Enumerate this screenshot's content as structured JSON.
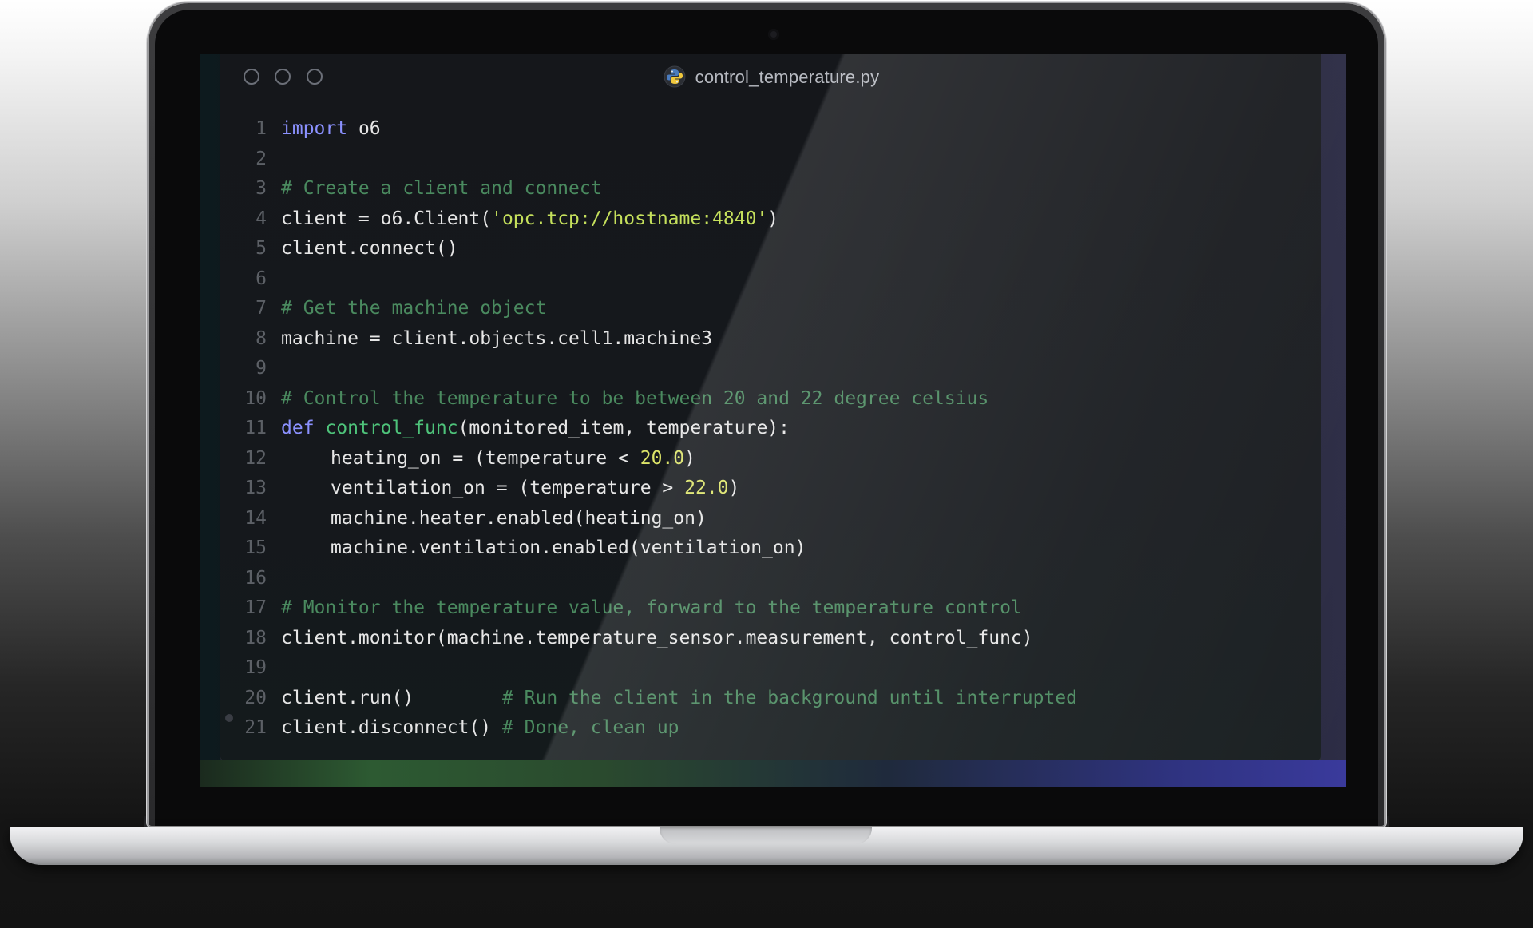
{
  "window": {
    "file_name": "control_temperature.py",
    "file_icon": "python-icon"
  },
  "code_lines": [
    {
      "n": "1",
      "tokens": [
        {
          "t": "import",
          "c": "kw"
        },
        {
          "t": " o6",
          "c": ""
        }
      ]
    },
    {
      "n": "2",
      "tokens": []
    },
    {
      "n": "3",
      "tokens": [
        {
          "t": "# Create a client and connect",
          "c": "cm"
        }
      ]
    },
    {
      "n": "4",
      "tokens": [
        {
          "t": "client = o6.Client(",
          "c": ""
        },
        {
          "t": "'opc.tcp://hostname:4840'",
          "c": "str"
        },
        {
          "t": ")",
          "c": ""
        }
      ]
    },
    {
      "n": "5",
      "tokens": [
        {
          "t": "client.connect()",
          "c": ""
        }
      ]
    },
    {
      "n": "6",
      "tokens": []
    },
    {
      "n": "7",
      "tokens": [
        {
          "t": "# Get the machine object",
          "c": "cm"
        }
      ]
    },
    {
      "n": "8",
      "tokens": [
        {
          "t": "machine = client.objects.cell1.machine3",
          "c": ""
        }
      ]
    },
    {
      "n": "9",
      "tokens": []
    },
    {
      "n": "10",
      "tokens": [
        {
          "t": "# Control the temperature to be between 20 and 22 degree celsius",
          "c": "cm"
        }
      ]
    },
    {
      "n": "11",
      "tokens": [
        {
          "t": "def",
          "c": "kw"
        },
        {
          "t": " ",
          "c": ""
        },
        {
          "t": "control_func",
          "c": "fn"
        },
        {
          "t": "(monitored_item, temperature):",
          "c": ""
        }
      ]
    },
    {
      "n": "12",
      "indent": true,
      "tokens": [
        {
          "t": "heating_on = (temperature < ",
          "c": ""
        },
        {
          "t": "20.0",
          "c": "num"
        },
        {
          "t": ")",
          "c": ""
        }
      ]
    },
    {
      "n": "13",
      "indent": true,
      "tokens": [
        {
          "t": "ventilation_on = (temperature > ",
          "c": ""
        },
        {
          "t": "22.0",
          "c": "num"
        },
        {
          "t": ")",
          "c": ""
        }
      ]
    },
    {
      "n": "14",
      "indent": true,
      "tokens": [
        {
          "t": "machine.heater.enabled(heating_on)",
          "c": ""
        }
      ]
    },
    {
      "n": "15",
      "indent": true,
      "tokens": [
        {
          "t": "machine.ventilation.enabled(ventilation_on)",
          "c": ""
        }
      ]
    },
    {
      "n": "16",
      "tokens": []
    },
    {
      "n": "17",
      "tokens": [
        {
          "t": "# Monitor the temperature value, forward to the temperature control",
          "c": "cm"
        }
      ]
    },
    {
      "n": "18",
      "tokens": [
        {
          "t": "client.monitor(machine.temperature_sensor.measurement, control_func)",
          "c": ""
        }
      ]
    },
    {
      "n": "19",
      "tokens": []
    },
    {
      "n": "20",
      "tokens": [
        {
          "t": "client.run()        ",
          "c": ""
        },
        {
          "t": "# Run the client in the background until interrupted",
          "c": "cm"
        }
      ]
    },
    {
      "n": "21",
      "tokens": [
        {
          "t": "client.disconnect() ",
          "c": ""
        },
        {
          "t": "# Done, clean up",
          "c": "cm"
        }
      ]
    }
  ],
  "colors": {
    "keyword": "#8b91ff",
    "function": "#4ec37a",
    "string": "#c5e05c",
    "number": "#dce468",
    "comment": "#4a8a5f",
    "text": "#e6e6e6",
    "line_number": "#5c6066"
  }
}
